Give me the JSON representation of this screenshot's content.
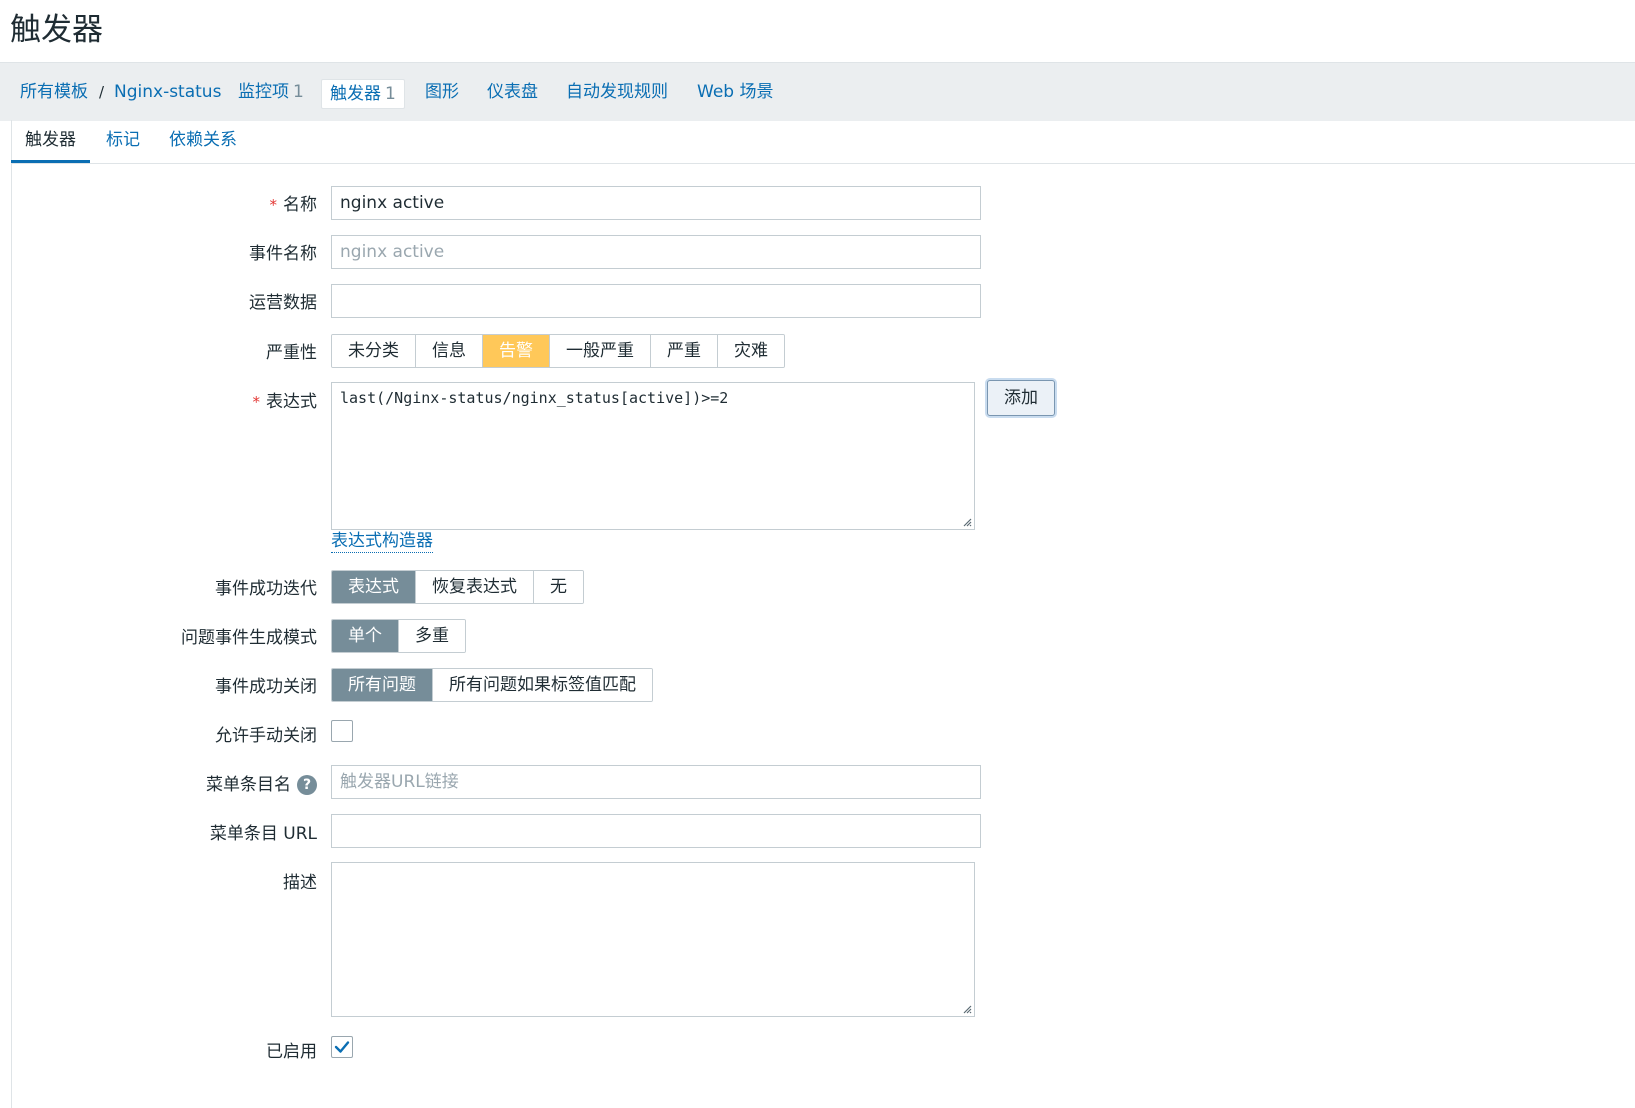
{
  "page": {
    "title": "触发器"
  },
  "breadcrumb": {
    "all_templates": "所有模板",
    "separator": "/",
    "template_name": "Nginx-status",
    "items": [
      {
        "label": "监控项",
        "count": "1"
      },
      {
        "label": "触发器",
        "count": "1"
      },
      {
        "label": "图形",
        "count": ""
      },
      {
        "label": "仪表盘",
        "count": ""
      },
      {
        "label": "自动发现规则",
        "count": ""
      },
      {
        "label": "Web 场景",
        "count": ""
      }
    ]
  },
  "tabs": [
    "触发器",
    "标记",
    "依赖关系"
  ],
  "form": {
    "name": {
      "label": "名称",
      "value": "nginx active",
      "required": true
    },
    "event_name": {
      "label": "事件名称",
      "placeholder": "nginx active"
    },
    "opdata": {
      "label": "运营数据",
      "value": ""
    },
    "severity": {
      "label": "严重性",
      "options": [
        "未分类",
        "信息",
        "告警",
        "一般严重",
        "严重",
        "灾难"
      ],
      "selected": "告警"
    },
    "expression": {
      "label": "表达式",
      "value": "last(/Nginx-status/nginx_status[active])>=2",
      "add_button": "添加",
      "constructor_link": "表达式构造器"
    },
    "ok_event_generation": {
      "label": "事件成功迭代",
      "options": [
        "表达式",
        "恢复表达式",
        "无"
      ],
      "selected": "表达式"
    },
    "problem_mode": {
      "label": "问题事件生成模式",
      "options": [
        "单个",
        "多重"
      ],
      "selected": "单个"
    },
    "ok_event_closes": {
      "label": "事件成功关闭",
      "options": [
        "所有问题",
        "所有问题如果标签值匹配"
      ],
      "selected": "所有问题"
    },
    "manual_close": {
      "label": "允许手动关闭",
      "checked": false
    },
    "menu_entry_name": {
      "label": "菜单条目名",
      "placeholder": "触发器URL链接",
      "help": "?"
    },
    "menu_entry_url": {
      "label": "菜单条目 URL",
      "value": ""
    },
    "description": {
      "label": "描述",
      "value": ""
    },
    "enabled": {
      "label": "已启用",
      "checked": true
    }
  },
  "colors": {
    "link": "#0a6eb3",
    "warning": "#ffc859",
    "selected": "#768d99",
    "required": "#e33734"
  }
}
